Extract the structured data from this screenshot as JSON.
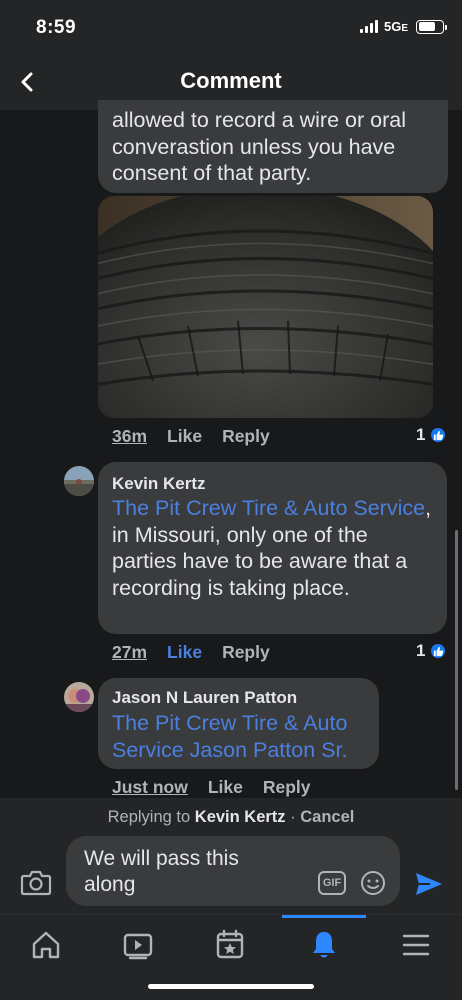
{
  "status": {
    "time": "8:59",
    "network": "5G",
    "network_suffix": "E",
    "battery_level": 0.7
  },
  "nav": {
    "title": "Comment",
    "back_icon": "chevron-left-icon"
  },
  "original_comment": {
    "text_tail": "allowed to record a wire or oral converastion unless you have consent of that party.",
    "has_photo": true,
    "timestamp": "36m",
    "like_label": "Like",
    "reply_label": "Reply",
    "reaction_count": "1"
  },
  "replies": [
    {
      "author": "Kevin Kertz",
      "mention": "The Pit Crew Tire & Auto Service",
      "text": ", in Missouri, only one of the parties have to be aware that a recording is taking place.",
      "timestamp": "27m",
      "like_label": "Like",
      "liked": true,
      "reply_label": "Reply",
      "reaction_count": "1"
    },
    {
      "author": "Jason N Lauren Patton",
      "mention": "The Pit Crew Tire & Auto Service Jason Patton Sr.",
      "text": "",
      "timestamp": "Just now",
      "like_label": "Like",
      "liked": false,
      "reply_label": "Reply"
    }
  ],
  "composer": {
    "replying_prefix": "Replying to",
    "replying_to": "Kevin Kertz",
    "separator": "·",
    "cancel_label": "Cancel",
    "input_value": "We will pass this along",
    "gif_label": "GIF"
  },
  "tabs": [
    {
      "icon": "home-icon",
      "active": false
    },
    {
      "icon": "video-icon",
      "active": false
    },
    {
      "icon": "marketplace-icon",
      "active": false
    },
    {
      "icon": "bell-icon",
      "active": true
    },
    {
      "icon": "menu-icon",
      "active": false
    }
  ],
  "colors": {
    "background": "#18191a",
    "bubble": "#3a3b3c",
    "link": "#4b7fe0",
    "accent": "#2d88ff"
  }
}
